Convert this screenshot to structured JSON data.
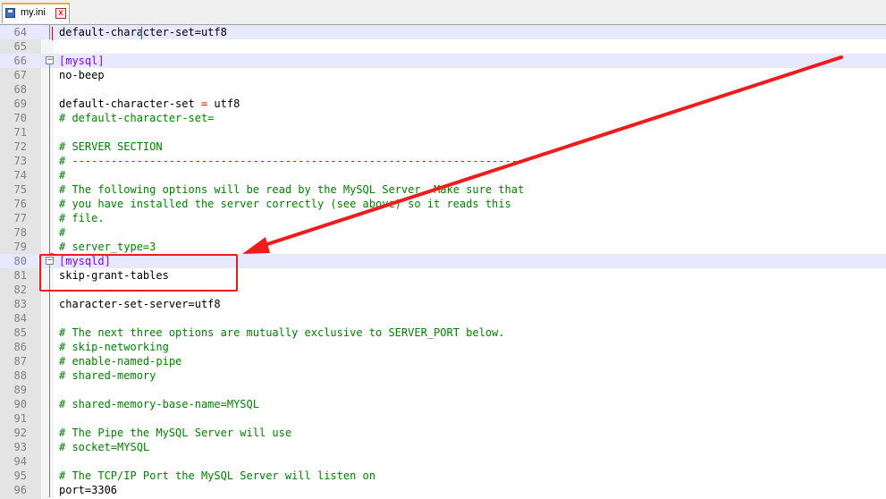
{
  "tab": {
    "label": "my.ini",
    "save_icon": "floppy-disk-icon",
    "close_glyph": "x"
  },
  "editor": {
    "lines": [
      {
        "n": "64",
        "text": "default-character-set=utf8",
        "kind": "plain",
        "hl": true
      },
      {
        "n": "65",
        "text": "",
        "kind": "plain"
      },
      {
        "n": "66",
        "text": "[mysql]",
        "kind": "section",
        "hl": true,
        "fold": true
      },
      {
        "n": "67",
        "text": "no-beep",
        "kind": "plain"
      },
      {
        "n": "68",
        "text": "",
        "kind": "plain"
      },
      {
        "n": "69",
        "text": "default-character-set = utf8",
        "kind": "plain"
      },
      {
        "n": "70",
        "text": "# default-character-set=",
        "kind": "comment"
      },
      {
        "n": "71",
        "text": "",
        "kind": "plain"
      },
      {
        "n": "72",
        "text": "# SERVER SECTION",
        "kind": "comment"
      },
      {
        "n": "73",
        "text": "# ----------------------------------------------------------------------",
        "kind": "comment"
      },
      {
        "n": "74",
        "text": "#",
        "kind": "comment"
      },
      {
        "n": "75",
        "text": "# The following options will be read by the MySQL Server. Make sure that",
        "kind": "comment"
      },
      {
        "n": "76",
        "text": "# you have installed the server correctly (see above) so it reads this",
        "kind": "comment"
      },
      {
        "n": "77",
        "text": "# file.",
        "kind": "comment"
      },
      {
        "n": "78",
        "text": "#",
        "kind": "comment"
      },
      {
        "n": "79",
        "text": "# server_type=3",
        "kind": "comment"
      },
      {
        "n": "80",
        "text": "[mysqld]",
        "kind": "section",
        "hl": true,
        "fold": true
      },
      {
        "n": "81",
        "text": "skip-grant-tables",
        "kind": "plain"
      },
      {
        "n": "82",
        "text": "",
        "kind": "plain"
      },
      {
        "n": "83",
        "text": "character-set-server=utf8",
        "kind": "plain"
      },
      {
        "n": "84",
        "text": "",
        "kind": "plain"
      },
      {
        "n": "85",
        "text": "# The next three options are mutually exclusive to SERVER_PORT below.",
        "kind": "comment"
      },
      {
        "n": "86",
        "text": "# skip-networking",
        "kind": "comment"
      },
      {
        "n": "87",
        "text": "# enable-named-pipe",
        "kind": "comment"
      },
      {
        "n": "88",
        "text": "# shared-memory",
        "kind": "comment"
      },
      {
        "n": "89",
        "text": "",
        "kind": "plain"
      },
      {
        "n": "90",
        "text": "# shared-memory-base-name=MYSQL",
        "kind": "comment"
      },
      {
        "n": "91",
        "text": "",
        "kind": "plain"
      },
      {
        "n": "92",
        "text": "# The Pipe the MySQL Server will use",
        "kind": "comment"
      },
      {
        "n": "93",
        "text": "# socket=MYSQL",
        "kind": "comment"
      },
      {
        "n": "94",
        "text": "",
        "kind": "plain"
      },
      {
        "n": "95",
        "text": "# The TCP/IP Port the MySQL Server will listen on",
        "kind": "comment"
      },
      {
        "n": "96",
        "text": "port=3306",
        "kind": "plain"
      }
    ]
  },
  "annotation": {
    "highlight_color": "#ee1c1c",
    "arrow_color": "#ee1c1c"
  },
  "colors": {
    "comment": "#008000",
    "section": "#8000ff",
    "operator": "#ff0000",
    "line_number": "#808080"
  }
}
